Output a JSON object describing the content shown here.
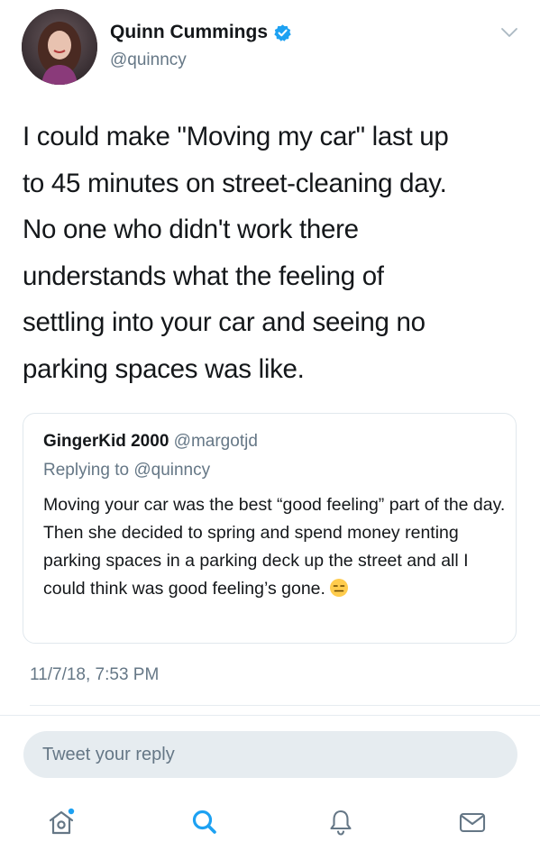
{
  "user": {
    "display_name": "Quinn Cummings",
    "handle": "@quinncy",
    "verified": true
  },
  "tweet": {
    "text": "I could make \"Moving my car\" last up\nto 45 minutes on street-cleaning day.\nNo one who didn't work there\nunderstands what the feeling of\nsettling into your car and seeing no\nparking spaces was like.",
    "timestamp": "11/7/18, 7:53 PM"
  },
  "quoted": {
    "display_name": "GingerKid 2000",
    "handle": "@margotjd",
    "replying_prefix": "Replying to",
    "replying_handle": "@quinncy",
    "text": "Moving your car was the best “good feeling” part of the day. Then she decided to spring and spend money renting parking spaces in a parking deck up the street and all I could think was good feeling’s gone."
  },
  "reply": {
    "placeholder": "Tweet your reply"
  },
  "tabs": [
    {
      "icon": "home-icon",
      "has_notification_dot": true
    },
    {
      "icon": "search-icon",
      "active": true
    },
    {
      "icon": "bell-icon"
    },
    {
      "icon": "mail-icon"
    }
  ],
  "colors": {
    "accent": "#1da1f2",
    "secondary_text": "#657786",
    "reply_background": "#e6ecf0"
  }
}
